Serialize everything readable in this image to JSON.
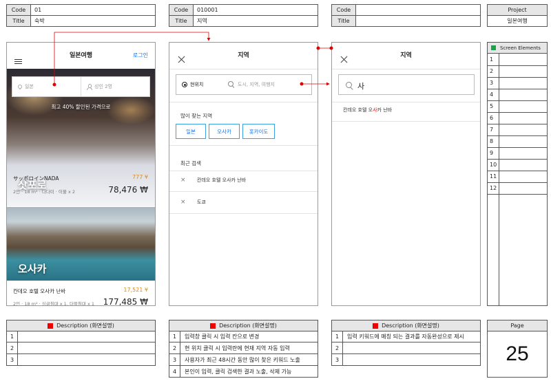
{
  "meta": {
    "code_label": "Code",
    "title_label": "Title",
    "project_label": "Project",
    "screen_elements_label": "Screen Elements",
    "description_label": "Description (화면설명)",
    "page_label": "Page"
  },
  "headers": [
    {
      "code": "01",
      "title": "숙박"
    },
    {
      "code": "010001",
      "title": "지역"
    },
    {
      "code": "",
      "title": ""
    }
  ],
  "project": {
    "name": "일본여행"
  },
  "screen_elements": [
    "1",
    "2",
    "3",
    "4",
    "5",
    "6",
    "7",
    "8",
    "9",
    "10",
    "11",
    "12"
  ],
  "page_number": "25",
  "screen1": {
    "title": "일본여행",
    "login": "로그인",
    "location_placeholder": "일본",
    "guests_placeholder": "성인 2명",
    "promo": "최고 40% 할인된 가격으로",
    "hotels": [
      {
        "city": "삿포로",
        "name": "サッポロインNADA",
        "price_yen": "777 ¥",
        "detail": "2인 · 18 m² · 다다미 · 이불 x 2",
        "price_won": "78,476 ₩"
      },
      {
        "city": "오사카",
        "name": "칸데오 호텔 오사카 난바",
        "price_yen": "17,521 ¥",
        "detail": "2인 · 18 m² · 싱글침대 x 1, 더블침대 x 1",
        "price_won": "177,485 ₩"
      }
    ]
  },
  "screen2": {
    "title": "지역",
    "current_location": "현위치",
    "search_placeholder": "도시, 지역, 여행지",
    "popular_title": "많이 찾는 지역",
    "popular": [
      "일본",
      "오사카",
      "홋카이도"
    ],
    "recent_title": "최근 검색",
    "recent": [
      "칸데오 호텔 오사카 난바",
      "도쿄"
    ]
  },
  "screen3": {
    "title": "지역",
    "search_value": "사",
    "result_prefix": "칸데오 호텔 오",
    "result_highlight": "사",
    "result_suffix": "카 난바"
  },
  "descriptions": [
    {
      "rows": [
        {
          "n": "1",
          "text": ""
        },
        {
          "n": "2",
          "text": ""
        },
        {
          "n": "3",
          "text": ""
        }
      ]
    },
    {
      "rows": [
        {
          "n": "1",
          "text": "입력창 클릭 시 입력 칸으로 변경"
        },
        {
          "n": "2",
          "text": "현 위치 클릭 시 입력란에 현재 지역 자동 입력"
        },
        {
          "n": "3",
          "text": "사용자가 최근 48시간 동안 많이 찾은 키워드 노출"
        },
        {
          "n": "4",
          "text": "본인이 입력, 클릭 검색한 결과 노출, 삭제 가능"
        }
      ]
    },
    {
      "rows": [
        {
          "n": "1",
          "text": "입력 키워드에 매칭 되는 결과를 자동완성으로 제시"
        },
        {
          "n": "2",
          "text": ""
        },
        {
          "n": "3",
          "text": ""
        }
      ]
    }
  ],
  "colors": {
    "accent": "#1a73e8",
    "price": "#d98b1c",
    "flow_arrow": "#e00000",
    "marker": "#e00000",
    "elements": "#1aa34a"
  },
  "icons": [
    "hamburger-icon",
    "close-icon",
    "search-icon",
    "pin-icon",
    "person-icon",
    "location-target-icon"
  ]
}
